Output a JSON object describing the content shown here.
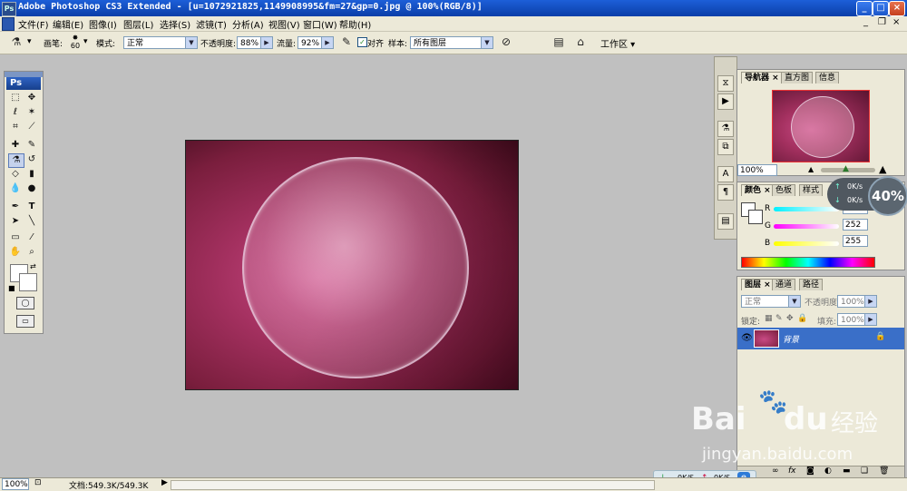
{
  "window": {
    "title": "Adobe Photoshop CS3 Extended - [u=1072921825,1149908995&fm=27&gp=0.jpg @ 100%(RGB/8)]",
    "logo": "Ps",
    "minimize": "_",
    "maximize": "□",
    "close": "×"
  },
  "menu": [
    "文件(F)",
    "编辑(E)",
    "图像(I)",
    "图层(L)",
    "选择(S)",
    "滤镜(T)",
    "分析(A)",
    "视图(V)",
    "窗口(W)",
    "帮助(H)"
  ],
  "doc_controls": {
    "minimize": "_",
    "restore": "❐",
    "close": "×"
  },
  "options": {
    "brush_label": "画笔:",
    "brush_size": "60",
    "mode_label": "模式:",
    "mode_value": "正常",
    "opacity_label": "不透明度:",
    "opacity_value": "88%",
    "flow_label": "流量:",
    "flow_value": "92%",
    "aligned_label": "对齐",
    "sample_label": "样本:",
    "sample_value": "所有图层",
    "workspace_label": "工作区 ▾"
  },
  "tools": {
    "header": "Ps",
    "labels": [
      "T"
    ]
  },
  "navigator": {
    "tabs": [
      "导航器 ×",
      "直方图",
      "信息"
    ],
    "zoom": "100%"
  },
  "color": {
    "tabs": [
      "颜色 ×",
      "色板",
      "样式"
    ],
    "r_label": "R",
    "g_label": "G",
    "b_label": "B",
    "r_value": "255",
    "g_value": "252",
    "b_value": "255"
  },
  "layers": {
    "tabs": [
      "图层 ×",
      "通道",
      "路径"
    ],
    "mode_value": "正常",
    "opacity_label": "不透明度:",
    "opacity_value": "100%",
    "lock_label": "锁定:",
    "fill_label": "填充:",
    "fill_value": "100%",
    "layer_name": "背景"
  },
  "status": {
    "zoom": "100%",
    "doc_info": "文档:549.3K/549.3K"
  },
  "net_meter": {
    "percent": "40%",
    "up": "0K/s",
    "down": "0K/s"
  },
  "net_bar": {
    "down": "0K/S",
    "up": "0K/S"
  },
  "watermark": {
    "brand": "Bai",
    "brand2": "du",
    "cn": "经验",
    "url": "jingyan.baidu.com"
  },
  "colors": {
    "accent": "#0a3ea8",
    "layer_selected": "#3a6fc8",
    "canvas_pink": "#c94a84"
  }
}
